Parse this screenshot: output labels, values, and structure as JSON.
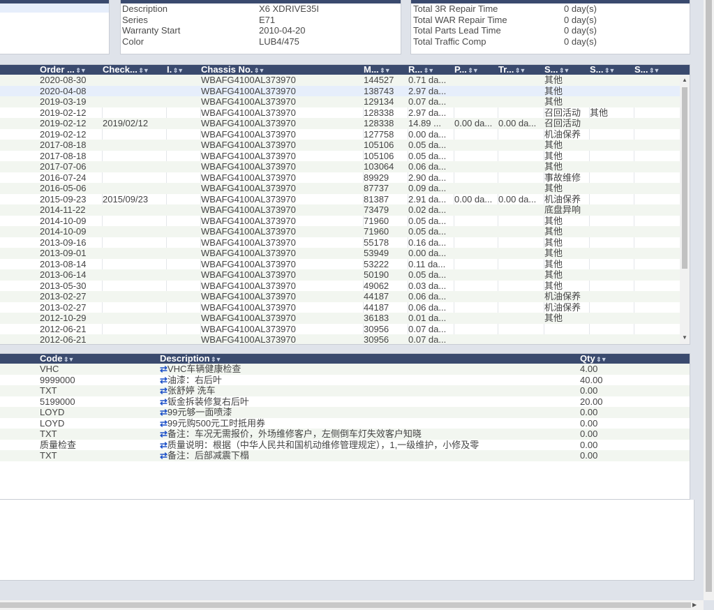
{
  "vehicle_info": {
    "rows": [
      {
        "label": "Description",
        "value": "X6 XDRIVE35I"
      },
      {
        "label": "Series",
        "value": "E71"
      },
      {
        "label": "Warranty Start",
        "value": "2010-04-20"
      },
      {
        "label": "Color",
        "value": "LUB4/475"
      }
    ]
  },
  "time_summary": {
    "rows": [
      {
        "label": "Total 3R Repair Time",
        "value": "0 day(s)"
      },
      {
        "label": "Total WAR Repair Time",
        "value": "0 day(s)"
      },
      {
        "label": "Total Parts Lead Time",
        "value": "0 day(s)"
      },
      {
        "label": "Total Traffic Comp",
        "value": "0 day(s)"
      }
    ]
  },
  "orders_grid": {
    "columns": [
      "Order ...",
      "Check...",
      "I.",
      "Chassis No.",
      "M...",
      "R...",
      "P...",
      "Tr...",
      "S...",
      "S...",
      "S..."
    ],
    "rows": [
      [
        "2020-08-30",
        "",
        "",
        "WBAFG4100AL373970",
        "144527",
        "0.71 da...",
        "",
        "",
        "其他",
        "",
        ""
      ],
      [
        "2020-04-08",
        "",
        "",
        "WBAFG4100AL373970",
        "138743",
        "2.97 da...",
        "",
        "",
        "其他",
        "",
        ""
      ],
      [
        "2019-03-19",
        "",
        "",
        "WBAFG4100AL373970",
        "129134",
        "0.07 da...",
        "",
        "",
        "其他",
        "",
        ""
      ],
      [
        "2019-02-12",
        "",
        "",
        "WBAFG4100AL373970",
        "128338",
        "2.97 da...",
        "",
        "",
        "召回活动",
        "其他",
        ""
      ],
      [
        "2019-02-12",
        "2019/02/12",
        "",
        "WBAFG4100AL373970",
        "128338",
        "14.89 ...",
        "0.00 da...",
        "0.00 da...",
        "召回活动",
        "",
        ""
      ],
      [
        "2019-02-12",
        "",
        "",
        "WBAFG4100AL373970",
        "127758",
        "0.00 da...",
        "",
        "",
        "机油保养",
        "",
        ""
      ],
      [
        "2017-08-18",
        "",
        "",
        "WBAFG4100AL373970",
        "105106",
        "0.05 da...",
        "",
        "",
        "其他",
        "",
        ""
      ],
      [
        "2017-08-18",
        "",
        "",
        "WBAFG4100AL373970",
        "105106",
        "0.05 da...",
        "",
        "",
        "其他",
        "",
        ""
      ],
      [
        "2017-07-06",
        "",
        "",
        "WBAFG4100AL373970",
        "103064",
        "0.06 da...",
        "",
        "",
        "其他",
        "",
        ""
      ],
      [
        "2016-07-24",
        "",
        "",
        "WBAFG4100AL373970",
        "89929",
        "2.90 da...",
        "",
        "",
        "事故维修",
        "",
        ""
      ],
      [
        "2016-05-06",
        "",
        "",
        "WBAFG4100AL373970",
        "87737",
        "0.09 da...",
        "",
        "",
        "其他",
        "",
        ""
      ],
      [
        "2015-09-23",
        "2015/09/23",
        "",
        "WBAFG4100AL373970",
        "81387",
        "2.91 da...",
        "0.00 da...",
        "0.00 da...",
        "机油保养",
        "",
        ""
      ],
      [
        "2014-11-22",
        "",
        "",
        "WBAFG4100AL373970",
        "73479",
        "0.02 da...",
        "",
        "",
        "底盘异响",
        "",
        ""
      ],
      [
        "2014-10-09",
        "",
        "",
        "WBAFG4100AL373970",
        "71960",
        "0.05 da...",
        "",
        "",
        "其他",
        "",
        ""
      ],
      [
        "2014-10-09",
        "",
        "",
        "WBAFG4100AL373970",
        "71960",
        "0.05 da...",
        "",
        "",
        "其他",
        "",
        ""
      ],
      [
        "2013-09-16",
        "",
        "",
        "WBAFG4100AL373970",
        "55178",
        "0.16 da...",
        "",
        "",
        "其他",
        "",
        ""
      ],
      [
        "2013-09-01",
        "",
        "",
        "WBAFG4100AL373970",
        "53949",
        "0.00 da...",
        "",
        "",
        "其他",
        "",
        ""
      ],
      [
        "2013-08-14",
        "",
        "",
        "WBAFG4100AL373970",
        "53222",
        "0.11 da...",
        "",
        "",
        "其他",
        "",
        ""
      ],
      [
        "2013-06-14",
        "",
        "",
        "WBAFG4100AL373970",
        "50190",
        "0.05 da...",
        "",
        "",
        "其他",
        "",
        ""
      ],
      [
        "2013-05-30",
        "",
        "",
        "WBAFG4100AL373970",
        "49062",
        "0.03 da...",
        "",
        "",
        "其他",
        "",
        ""
      ],
      [
        "2013-02-27",
        "",
        "",
        "WBAFG4100AL373970",
        "44187",
        "0.06 da...",
        "",
        "",
        "机油保养",
        "",
        ""
      ],
      [
        "2013-02-27",
        "",
        "",
        "WBAFG4100AL373970",
        "44187",
        "0.06 da...",
        "",
        "",
        "机油保养",
        "",
        ""
      ],
      [
        "2012-10-29",
        "",
        "",
        "WBAFG4100AL373970",
        "36183",
        "0.01 da...",
        "",
        "",
        "其他",
        "",
        ""
      ],
      [
        "2012-06-21",
        "",
        "",
        "WBAFG4100AL373970",
        "30956",
        "0.07 da...",
        "",
        "",
        "",
        "",
        ""
      ],
      [
        "2012-06-21",
        "",
        "",
        "WBAFG4100AL373970",
        "30956",
        "0.07 da...",
        "",
        "",
        "",
        "",
        ""
      ]
    ]
  },
  "items_grid": {
    "columns": [
      "Code",
      "Description",
      "Qty"
    ],
    "rows": [
      [
        "VHC",
        "VHC车辆健康检查",
        "4.00"
      ],
      [
        "9999000",
        "油漆：右后叶",
        "40.00"
      ],
      [
        "TXT",
        "张舒婷 洗车",
        "0.00"
      ],
      [
        "5199000",
        "钣金拆装修复右后叶",
        "20.00"
      ],
      [
        "LOYD",
        "99元够一面喷漆",
        "0.00"
      ],
      [
        "LOYD",
        "99元购500元工时抵用券",
        "0.00"
      ],
      [
        "TXT",
        "备注：车况无需报价，外场维修客户，左侧倒车灯失效客户知晓",
        "0.00"
      ],
      [
        "质量检查",
        "质量说明：根据（中华人民共和国机动维修管理规定），1,一级维护，小修及零",
        "0.00"
      ],
      [
        "TXT",
        "备注：后部减震下榻",
        "0.00"
      ]
    ]
  },
  "icons": {
    "sort": "sort-updown-icon",
    "filter": "filter-funnel-icon",
    "swap": "swap-arrows-icon"
  },
  "colors": {
    "header": "#3a4a6e",
    "swap_icon": "#1f52c8"
  }
}
